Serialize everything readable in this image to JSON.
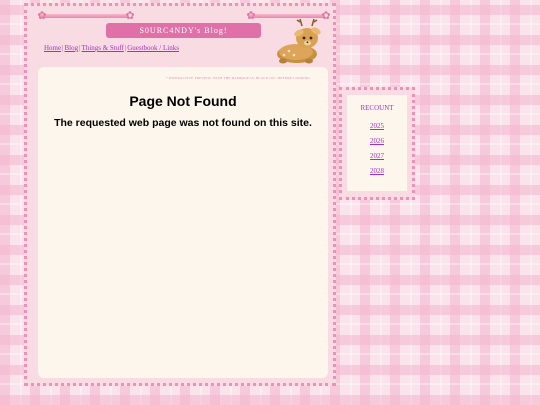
{
  "header": {
    "title": "S0URC4NDY's Blog!"
  },
  "nav": {
    "items": [
      {
        "label": "Home"
      },
      {
        "label": "Blog"
      },
      {
        "label": "Things & Stuff"
      },
      {
        "label": "Guestbook / Links"
      }
    ],
    "separator": "|"
  },
  "content": {
    "note": "* INTERACTIVE PREVIEW, WITH THE RAMPAGE IS, BLACK ON / BEFORE LOOKING",
    "heading": "Page Not Found",
    "message": "The requested web page was not found on this site."
  },
  "sidebar": {
    "title": "RECOUNT",
    "links": [
      {
        "label": "2025"
      },
      {
        "label": "2026"
      },
      {
        "label": "2027"
      },
      {
        "label": "2028"
      }
    ]
  },
  "colors": {
    "accent": "#df70a8",
    "link": "#a331c8",
    "panel": "#fdf6ec",
    "frame": "#f9dbe3"
  },
  "icons": {
    "mascot": "deer-plush-icon",
    "ribbon": "bow-icon"
  }
}
